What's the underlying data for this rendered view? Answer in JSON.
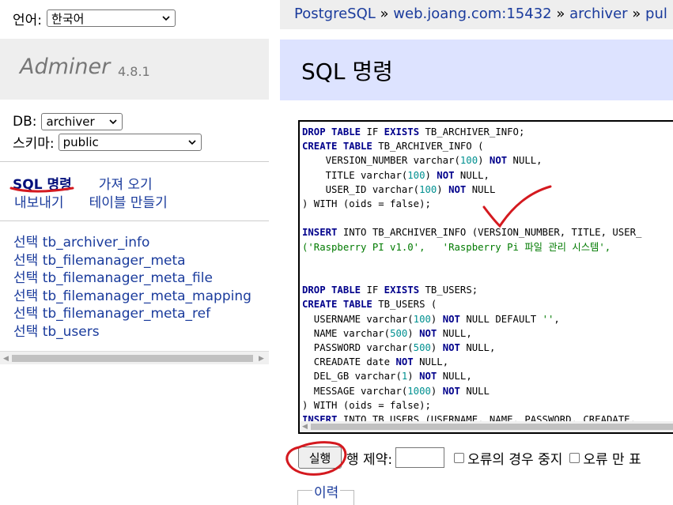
{
  "language": {
    "label": "언어:",
    "selected": "한국어"
  },
  "brand": {
    "name": "Adminer",
    "version": "4.8.1"
  },
  "db": {
    "label": "DB:",
    "selected": "archiver"
  },
  "schema": {
    "label": "스키마:",
    "selected": "public"
  },
  "menu": {
    "sql_command": "SQL 명령",
    "import": "가져 오기",
    "export": "내보내기",
    "create_table": "테이블 만들기"
  },
  "tables": [
    {
      "select": "선택",
      "name": "tb_archiver_info"
    },
    {
      "select": "선택",
      "name": "tb_filemanager_meta"
    },
    {
      "select": "선택",
      "name": "tb_filemanager_meta_file"
    },
    {
      "select": "선택",
      "name": "tb_filemanager_meta_mapping"
    },
    {
      "select": "선택",
      "name": "tb_filemanager_meta_ref"
    },
    {
      "select": "선택",
      "name": "tb_users"
    }
  ],
  "breadcrumb": {
    "items": [
      "PostgreSQL",
      "web.joang.com:15432",
      "archiver",
      "pul"
    ],
    "separator": "»"
  },
  "page_title": "SQL 명령",
  "sql_lines": [
    [
      [
        "kw",
        "DROP TABLE"
      ],
      [
        "t",
        " IF "
      ],
      [
        "kw",
        "EXISTS"
      ],
      [
        "t",
        " TB_ARCHIVER_INFO;"
      ]
    ],
    [
      [
        "kw",
        "CREATE TABLE"
      ],
      [
        "t",
        " TB_ARCHIVER_INFO ("
      ]
    ],
    [
      [
        "t",
        "    VERSION_NUMBER varchar("
      ],
      [
        "num",
        "100"
      ],
      [
        "t",
        ") "
      ],
      [
        "kw",
        "NOT"
      ],
      [
        "t",
        " NULL,"
      ]
    ],
    [
      [
        "t",
        "    TITLE varchar("
      ],
      [
        "num",
        "100"
      ],
      [
        "t",
        ") "
      ],
      [
        "kw",
        "NOT"
      ],
      [
        "t",
        " NULL,"
      ]
    ],
    [
      [
        "t",
        "    USER_ID varchar("
      ],
      [
        "num",
        "100"
      ],
      [
        "t",
        ") "
      ],
      [
        "kw",
        "NOT"
      ],
      [
        "t",
        " NULL"
      ]
    ],
    [
      [
        "t",
        ") WITH (oids = false);"
      ]
    ],
    [
      [
        "t",
        ""
      ]
    ],
    [
      [
        "kw",
        "INSERT"
      ],
      [
        "t",
        " INTO TB_ARCHIVER_INFO (VERSION_NUMBER, TITLE, USER_"
      ]
    ],
    [
      [
        "str",
        "('Raspberry PI v1.0',   'Raspberry Pi 파일 관리 시스템',"
      ]
    ],
    [
      [
        "t",
        ""
      ]
    ],
    [
      [
        "t",
        ""
      ]
    ],
    [
      [
        "kw",
        "DROP TABLE"
      ],
      [
        "t",
        " IF "
      ],
      [
        "kw",
        "EXISTS"
      ],
      [
        "t",
        " TB_USERS;"
      ]
    ],
    [
      [
        "kw",
        "CREATE TABLE"
      ],
      [
        "t",
        " TB_USERS ("
      ]
    ],
    [
      [
        "t",
        "  USERNAME varchar("
      ],
      [
        "num",
        "100"
      ],
      [
        "t",
        ") "
      ],
      [
        "kw",
        "NOT"
      ],
      [
        "t",
        " NULL DEFAULT "
      ],
      [
        "str",
        "''"
      ],
      [
        "t",
        ","
      ]
    ],
    [
      [
        "t",
        "  NAME varchar("
      ],
      [
        "num",
        "500"
      ],
      [
        "t",
        ") "
      ],
      [
        "kw",
        "NOT"
      ],
      [
        "t",
        " NULL,"
      ]
    ],
    [
      [
        "t",
        "  PASSWORD varchar("
      ],
      [
        "num",
        "500"
      ],
      [
        "t",
        ") "
      ],
      [
        "kw",
        "NOT"
      ],
      [
        "t",
        " NULL,"
      ]
    ],
    [
      [
        "t",
        "  CREADATE date "
      ],
      [
        "kw",
        "NOT"
      ],
      [
        "t",
        " NULL,"
      ]
    ],
    [
      [
        "t",
        "  DEL_GB varchar("
      ],
      [
        "num",
        "1"
      ],
      [
        "t",
        ") "
      ],
      [
        "kw",
        "NOT"
      ],
      [
        "t",
        " NULL,"
      ]
    ],
    [
      [
        "t",
        "  MESSAGE varchar("
      ],
      [
        "num",
        "1000"
      ],
      [
        "t",
        ") "
      ],
      [
        "kw",
        "NOT"
      ],
      [
        "t",
        " NULL"
      ]
    ],
    [
      [
        "t",
        ") WITH (oids = false);"
      ]
    ],
    [
      [
        "kw",
        "INSERT"
      ],
      [
        "t",
        " INTO TB_USERS (USERNAME, NAME, PASSWORD, CREADATE,"
      ]
    ]
  ],
  "exec": {
    "button": "실행",
    "limit_label": "행 제약:",
    "limit_value": "",
    "stop_on_error": "오류의 경우 중지",
    "errors_only": "오류 만 표"
  },
  "history": "이력",
  "colors": {
    "link": "#1a3b9c",
    "title_bg": "#dde3ff",
    "annotation": "#d4191f"
  }
}
